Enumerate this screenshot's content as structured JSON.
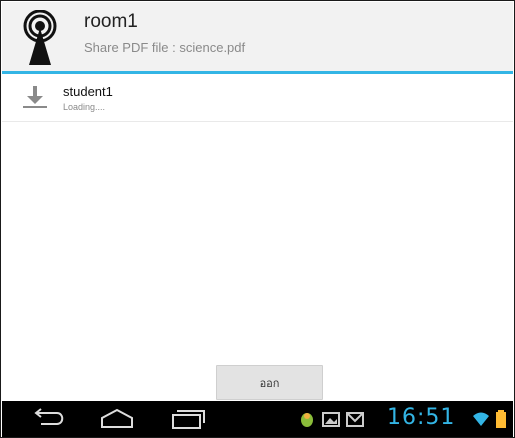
{
  "header": {
    "title": "room1",
    "subtitle": "Share PDF file : science.pdf",
    "icon": "broadcast-tower-icon"
  },
  "list": {
    "items": [
      {
        "name": "student1",
        "status": "Loading....",
        "icon": "download-icon"
      }
    ]
  },
  "footer": {
    "exit_label": "ออก"
  },
  "navbar": {
    "buttons": [
      "back-icon",
      "home-icon",
      "recent-apps-icon"
    ],
    "notification_icons": [
      "android-notification-icon",
      "image-notification-icon",
      "email-notification-icon"
    ],
    "clock": "16:51",
    "status_icons": [
      "wifi-icon",
      "battery-icon"
    ],
    "accent_color": "#33b5e5"
  },
  "colors": {
    "accent": "#33b5e5",
    "header_bg": "#f2f2f2",
    "navbar_bg": "#000000"
  }
}
